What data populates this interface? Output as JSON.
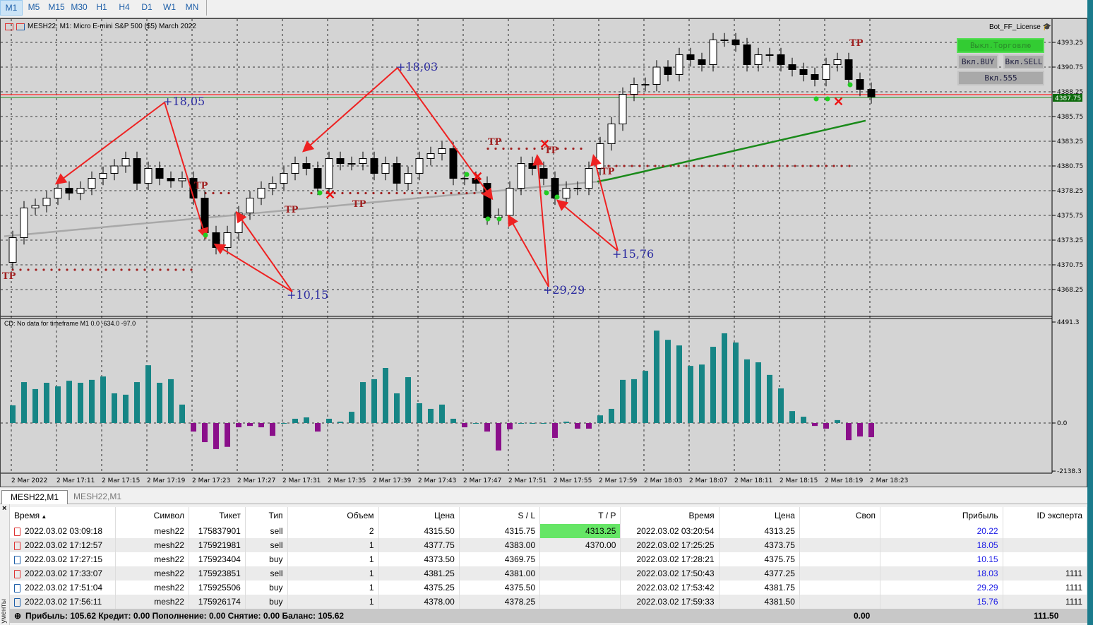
{
  "timeframes": [
    "M1",
    "M5",
    "M15",
    "M30",
    "H1",
    "H4",
    "D1",
    "W1",
    "MN"
  ],
  "active_timeframe": "M1",
  "chart": {
    "title": "MESH22, M1:  Micro E-mini S&P 500 ($5)  March 2022",
    "license": "Bot_FF_License",
    "buttons": {
      "trade": "Выкл.Торговлю",
      "buy": "Вкл.BUY",
      "sell": "Вкл.SELL",
      "b555": "Вкл.555"
    },
    "current_price": "4387.75",
    "price_ticks": [
      "4393.25",
      "4390.75",
      "4388.25",
      "4385.75",
      "4383.25",
      "4380.75",
      "4378.25",
      "4375.75",
      "4373.25",
      "4370.75",
      "4368.25"
    ],
    "time_ticks": [
      "2 Mar 2022",
      "2 Mar 17:11",
      "2 Mar 17:15",
      "2 Mar 17:19",
      "2 Mar 17:23",
      "2 Mar 17:27",
      "2 Mar 17:31",
      "2 Mar 17:35",
      "2 Mar 17:39",
      "2 Mar 17:43",
      "2 Mar 17:47",
      "2 Mar 17:51",
      "2 Mar 17:55",
      "2 Mar 17:59",
      "2 Mar 18:03",
      "2 Mar 18:07",
      "2 Mar 18:11",
      "2 Mar 18:15",
      "2 Mar 18:19",
      "2 Mar 18:23"
    ],
    "closes": [
      4373.5,
      4376.5,
      4376.75,
      4377.5,
      4378.5,
      4378.0,
      4378.5,
      4379.5,
      4380.0,
      4380.75,
      4381.5,
      4379.0,
      4380.5,
      4379.5,
      4379.25,
      4379.5,
      4377.5,
      4374.0,
      4372.5,
      4374.0,
      4376.0,
      4377.5,
      4378.5,
      4379.0,
      4380.0,
      4381.0,
      4380.5,
      4378.5,
      4381.5,
      4381.0,
      4381.0,
      4381.5,
      4380.0,
      4381.0,
      4379.0,
      4380.0,
      4381.5,
      4382.0,
      4382.5,
      4379.5,
      4379.5,
      4379.0,
      4375.5,
      4375.75,
      4378.5,
      4381.0,
      4380.5,
      4379.5,
      4377.5,
      4378.5,
      4378.5,
      4380.5,
      4383.0,
      4385.0,
      4388.0,
      4389.0,
      4389.0,
      4390.75,
      4390.0,
      4392.0,
      4391.5,
      4391.0,
      4393.5,
      4393.5,
      4393.0,
      4391.0,
      4392.0,
      4392.0,
      4391.0,
      4390.5,
      4390.0,
      4389.5,
      4391.0,
      4391.5,
      4389.5,
      4388.5,
      4387.75
    ],
    "annotations": [
      "+18,05",
      "+18,03",
      "+10,15",
      "+29,29",
      "+15,76"
    ],
    "tp_label": "TP",
    "colors": {
      "bg": "#d4d4d4",
      "bull": "#ffffff",
      "bear": "#000000",
      "arrow": "#ee2222",
      "ma": "#1a8a1a",
      "hist_pos": "#168585",
      "hist_neg": "#8a0f8a",
      "annot": "#2a2aa0"
    }
  },
  "indicator": {
    "label": "CD: No data for timeframe M1 0.0 -634.0 -97.0",
    "ticks": [
      "4491.3",
      "0.0",
      "-2138.3"
    ],
    "values": [
      785,
      1820,
      1510,
      1790,
      1630,
      1880,
      1790,
      1920,
      2070,
      1320,
      1260,
      1820,
      2570,
      1790,
      1950,
      820,
      -380,
      -850,
      -1160,
      -1060,
      -190,
      -130,
      -190,
      -570,
      0,
      190,
      250,
      -380,
      190,
      60,
      500,
      1820,
      1950,
      2450,
      1320,
      2040,
      880,
      630,
      820,
      190,
      -190,
      0,
      -380,
      -1220,
      -280,
      0,
      0,
      0,
      -660,
      60,
      -250,
      -250,
      340,
      630,
      1920,
      1950,
      2320,
      4110,
      3700,
      3450,
      2540,
      2600,
      3390,
      3990,
      3580,
      2830,
      2700,
      2140,
      1540,
      530,
      280,
      -130,
      -250,
      130,
      -760,
      -600,
      -630
    ]
  },
  "tabs": [
    "MESH22,M1",
    "MESH22,M1"
  ],
  "table": {
    "headers": [
      "Время",
      "Символ",
      "Тикет",
      "Тип",
      "Объем",
      "Цена",
      "S / L",
      "T / P",
      "Время",
      "Цена",
      "Своп",
      "Прибыль",
      "ID эксперта"
    ],
    "rows": [
      [
        "2022.03.02 03:09:18",
        "mesh22",
        "175837901",
        "sell",
        "2",
        "4315.50",
        "4315.75",
        "4313.25",
        "2022.03.02 03:20:54",
        "4313.25",
        "",
        "20.22",
        ""
      ],
      [
        "2022.03.02 17:12:57",
        "mesh22",
        "175921981",
        "sell",
        "1",
        "4377.75",
        "4383.00",
        "4370.00",
        "2022.03.02 17:25:25",
        "4373.75",
        "",
        "18.05",
        ""
      ],
      [
        "2022.03.02 17:27:15",
        "mesh22",
        "175923404",
        "buy",
        "1",
        "4373.50",
        "4369.75",
        "",
        "2022.03.02 17:28:21",
        "4375.75",
        "",
        "10.15",
        ""
      ],
      [
        "2022.03.02 17:33:07",
        "mesh22",
        "175923851",
        "sell",
        "1",
        "4381.25",
        "4381.00",
        "",
        "2022.03.02 17:50:43",
        "4377.25",
        "",
        "18.03",
        "1111"
      ],
      [
        "2022.03.02 17:51:04",
        "mesh22",
        "175925506",
        "buy",
        "1",
        "4375.25",
        "4375.50",
        "",
        "2022.03.02 17:53:42",
        "4381.75",
        "",
        "29.29",
        "1111"
      ],
      [
        "2022.03.02 17:56:11",
        "mesh22",
        "175926174",
        "buy",
        "1",
        "4378.00",
        "4378.25",
        "",
        "2022.03.02 17:59:33",
        "4381.50",
        "",
        "15.76",
        "1111"
      ]
    ],
    "summary": "Прибыль: 105.62  Кредит: 0.00  Пополнение: 0.00  Снятие: 0.00  Баланс: 105.62",
    "swap_total": "0.00",
    "profit_total": "111.50",
    "side_label": "ументы"
  }
}
